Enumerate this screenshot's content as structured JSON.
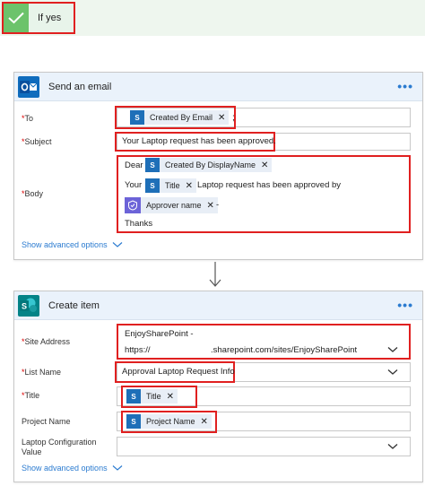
{
  "condition": {
    "label": "If yes"
  },
  "email_card": {
    "title": "Send an email",
    "more": "•••",
    "to_label": "To",
    "to_token": "Created By Email",
    "to_suffix": ";",
    "subject_label": "Subject",
    "subject_value": "Your Laptop request has been approved.",
    "body_label": "Body",
    "body_line1_prefix": "Dear",
    "body_line1_token": "Created By DisplayName",
    "body_line2_prefix": "Your",
    "body_line2_token": "Title",
    "body_line2_text": "Laptop request has been approved by",
    "body_line3_token": "Approver name",
    "body_line3_suffix": "-",
    "body_line4": "Thanks",
    "show_advanced": "Show advanced options"
  },
  "item_card": {
    "title": "Create item",
    "more": "•••",
    "site_label": "Site Address",
    "site_line1": "EnjoySharePoint -",
    "site_line2_prefix": "https://",
    "site_line2_suffix": ".sharepoint.com/sites/EnjoySharePoint",
    "list_label": "List Name",
    "list_value": "Approval Laptop Request Info",
    "title_label": "Title",
    "title_token": "Title",
    "project_label": "Project Name",
    "project_token": "Project Name",
    "laptop_label_1": "Laptop Configuration",
    "laptop_label_2": "Value",
    "show_advanced": "Show advanced options"
  },
  "required_mark": "*",
  "colors": {
    "accent": "#2b7bd0",
    "outlook": "#0f6cbd",
    "sharepoint": "#038387",
    "highlight": "#e02020",
    "approval": "#6c63d8"
  }
}
